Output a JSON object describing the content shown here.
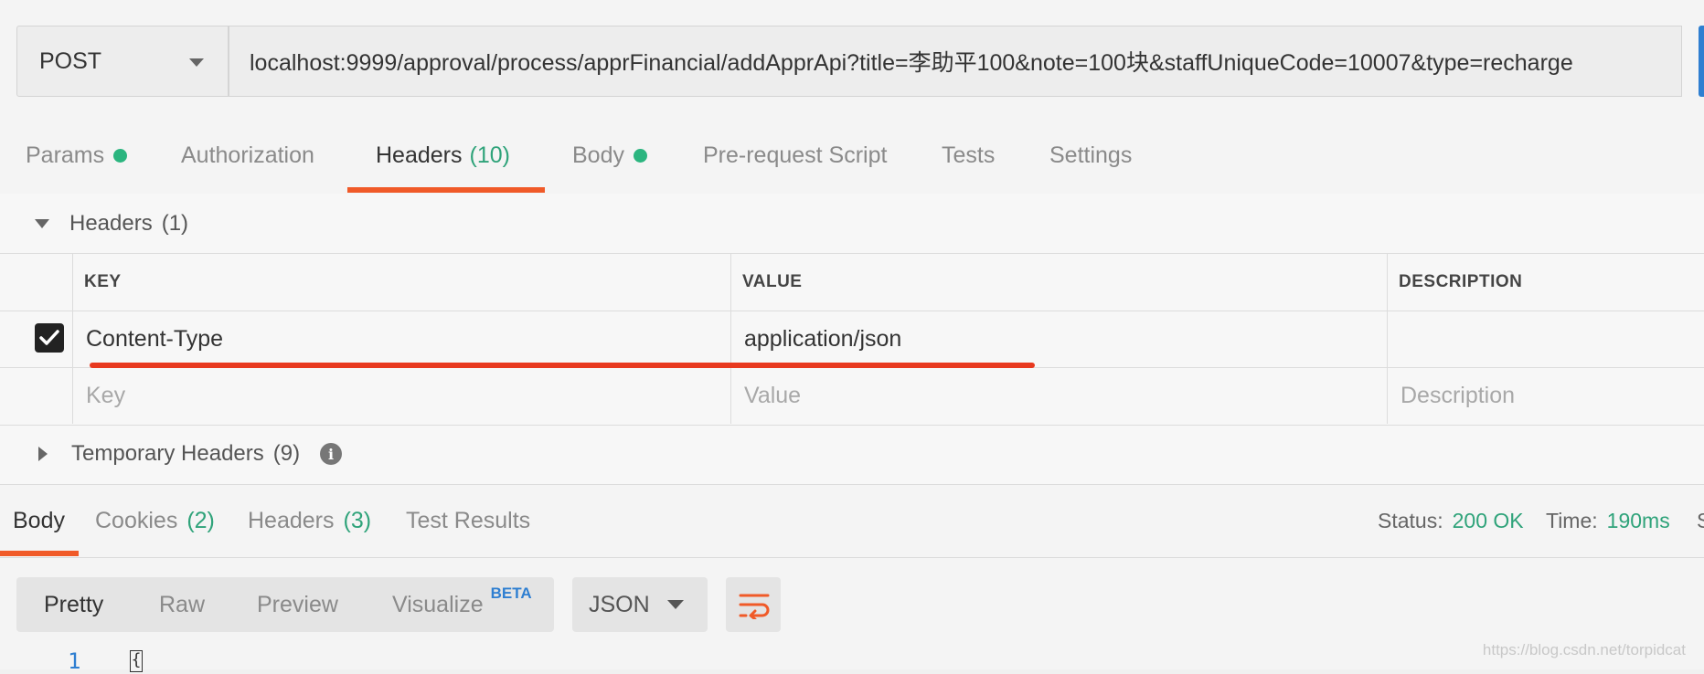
{
  "request": {
    "method": "POST",
    "url": "localhost:9999/approval/process/apprFinancial/addApprApi?title=李助平100&note=100块&staffUniqueCode=10007&type=recharge"
  },
  "request_tabs": {
    "params": "Params",
    "authorization": "Authorization",
    "headers": "Headers",
    "headers_count": "(10)",
    "body": "Body",
    "prerequest": "Pre-request Script",
    "tests": "Tests",
    "settings": "Settings"
  },
  "headers_section": {
    "title": "Headers",
    "count": "(1)",
    "columns": {
      "key": "KEY",
      "value": "VALUE",
      "description": "DESCRIPTION"
    },
    "rows": [
      {
        "checked": true,
        "key": "Content-Type",
        "value": "application/json",
        "description": ""
      }
    ],
    "placeholders": {
      "key": "Key",
      "value": "Value",
      "description": "Description"
    },
    "temporary_title": "Temporary Headers",
    "temporary_count": "(9)",
    "info_glyph": "i"
  },
  "response": {
    "tabs": {
      "body": "Body",
      "cookies": "Cookies",
      "cookies_count": "(2)",
      "headers": "Headers",
      "headers_count": "(3)",
      "test_results": "Test Results"
    },
    "status_label": "Status:",
    "status_value": "200 OK",
    "time_label": "Time:",
    "time_value": "190ms",
    "size_label_partial": "S",
    "modes": {
      "pretty": "Pretty",
      "raw": "Raw",
      "preview": "Preview",
      "visualize": "Visualize",
      "beta": "BETA"
    },
    "format": "JSON",
    "first_line_number": "1",
    "first_char": "{"
  },
  "watermark": "https://blog.csdn.net/torpidcat",
  "colors": {
    "accent_orange": "#f05a28",
    "green": "#2fa37a",
    "blue": "#2f7fd1",
    "annotation_red": "#e8391f"
  },
  "icons": [
    "chevron-down-icon",
    "checkbox-checked-icon",
    "info-icon",
    "wrap-lines-icon",
    "triangle-down-icon",
    "triangle-right-icon"
  ]
}
